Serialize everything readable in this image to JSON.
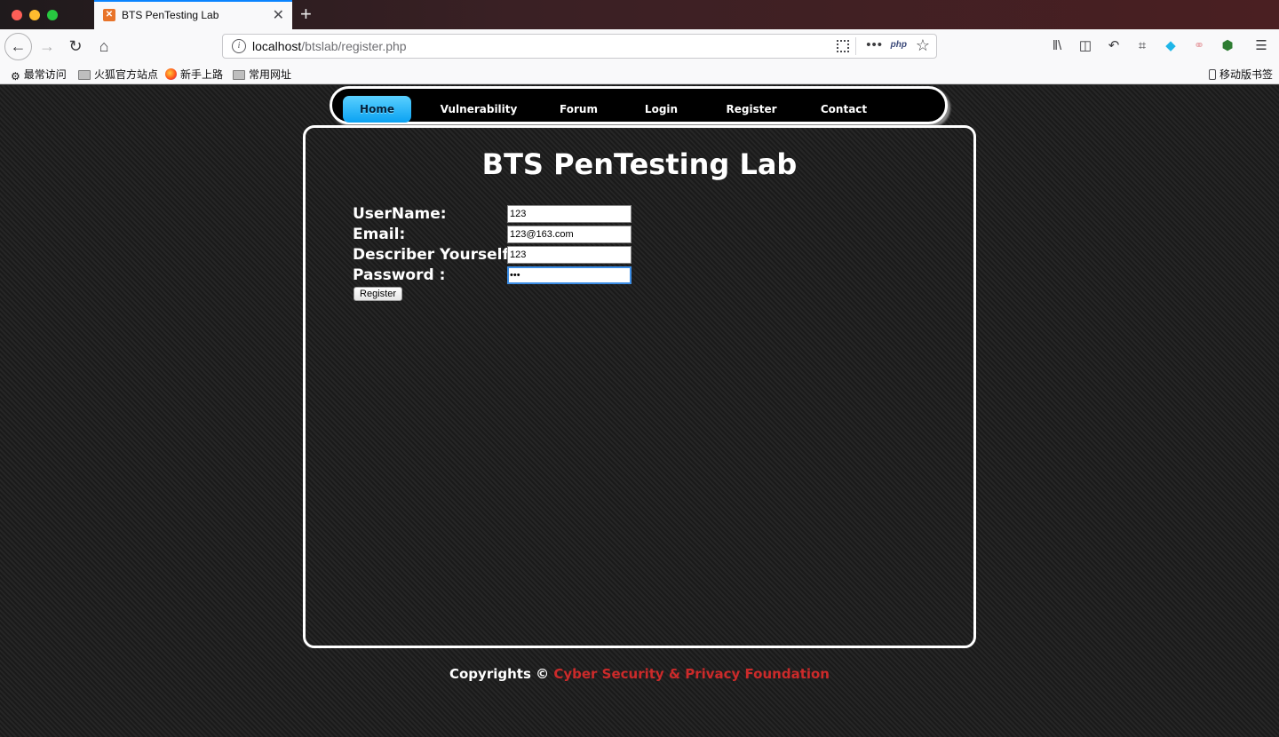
{
  "browser": {
    "tab_title": "BTS PenTesting Lab",
    "url_host": "localhost",
    "url_path": "/btslab/register.php",
    "url_php_label": "php",
    "bookmarks": [
      "最常访问",
      "火狐官方站点",
      "新手上路",
      "常用网址"
    ],
    "mobile_bookmarks": "移动版书签"
  },
  "nav": {
    "items": [
      "Home",
      "Vulnerability",
      "Forum",
      "Login",
      "Register",
      "Contact"
    ],
    "active": "Home"
  },
  "page": {
    "title": "BTS PenTesting Lab",
    "form": {
      "username_label": "UserName:",
      "username_value": "123",
      "email_label": "Email:",
      "email_value": "123@163.com",
      "describe_label": "Describer Yourself:",
      "describe_value": "123",
      "password_label": "Password :",
      "password_value": "•••",
      "submit_label": "Register"
    },
    "footer": {
      "copyright": "Copyrights ©",
      "org": "Cyber Security & Privacy Foundation"
    }
  },
  "colors": {
    "active_tab_accent": "#0a84ff",
    "menu_active": "#0aa2f2",
    "footer_org": "#cc2a2a"
  }
}
